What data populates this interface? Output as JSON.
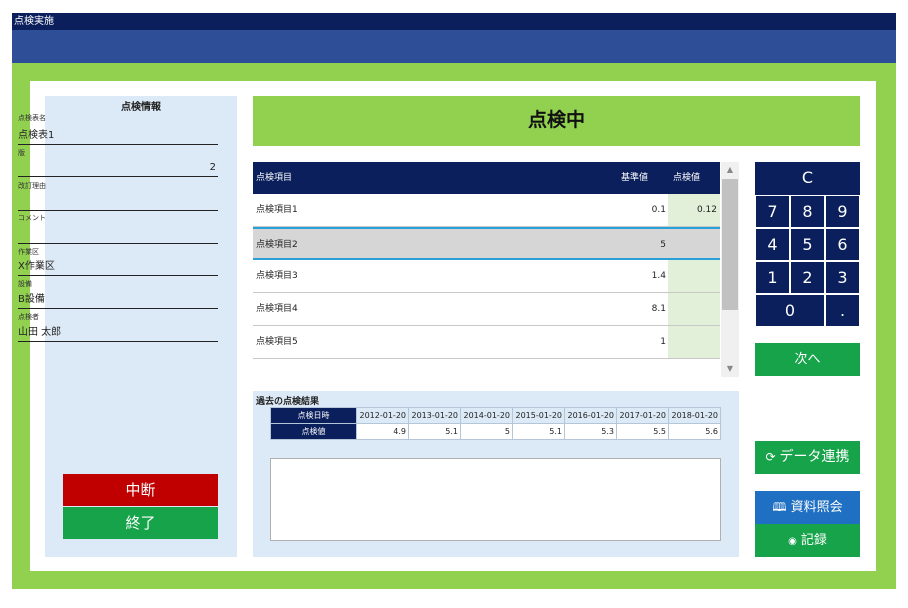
{
  "window": {
    "title": "点検実施"
  },
  "info": {
    "heading": "点検情報",
    "fields": [
      {
        "label": "点検表名",
        "value": "点検表1"
      },
      {
        "label": "版",
        "value": "2"
      },
      {
        "label": "改訂理由",
        "value": ""
      },
      {
        "label": "コメント",
        "value": ""
      },
      {
        "label": "作業区",
        "value": "X作業区"
      },
      {
        "label": "設備",
        "value": "B設備"
      },
      {
        "label": "点検者",
        "value": "山田 太郎"
      }
    ]
  },
  "buttons": {
    "suspend": "中断",
    "finish": "終了",
    "next": "次へ",
    "data_link": "データ連携",
    "docs": "資料照会",
    "record": "記録"
  },
  "status": "点検中",
  "table": {
    "headers": {
      "item": "点検項目",
      "standard": "基準値",
      "value": "点検値"
    },
    "rows": [
      {
        "item": "点検項目1",
        "standard": "0.1",
        "value": "0.12"
      },
      {
        "item": "点検項目2",
        "standard": "5",
        "value": ""
      },
      {
        "item": "点検項目3",
        "standard": "1.4",
        "value": ""
      },
      {
        "item": "点検項目4",
        "standard": "8.1",
        "value": ""
      },
      {
        "item": "点検項目5",
        "standard": "1",
        "value": ""
      }
    ],
    "selected_index": 1
  },
  "past": {
    "title": "過去の点検結果",
    "date_label": "点検日時",
    "value_label": "点検値",
    "dates": [
      "2012-01-20",
      "2013-01-20",
      "2014-01-20",
      "2015-01-20",
      "2016-01-20",
      "2017-01-20",
      "2018-01-20"
    ],
    "values": [
      "4.9",
      "5.1",
      "5",
      "5.1",
      "5.3",
      "5.5",
      "5.6"
    ]
  },
  "keypad": {
    "clear": "C",
    "keys": [
      "7",
      "8",
      "9",
      "4",
      "5",
      "6",
      "1",
      "2",
      "3",
      "0",
      "."
    ]
  },
  "colors": {
    "navy": "#0b1f5c",
    "green": "#92d050",
    "button_green": "#17a34a",
    "button_red": "#c00000",
    "button_blue": "#1f6fc2"
  }
}
